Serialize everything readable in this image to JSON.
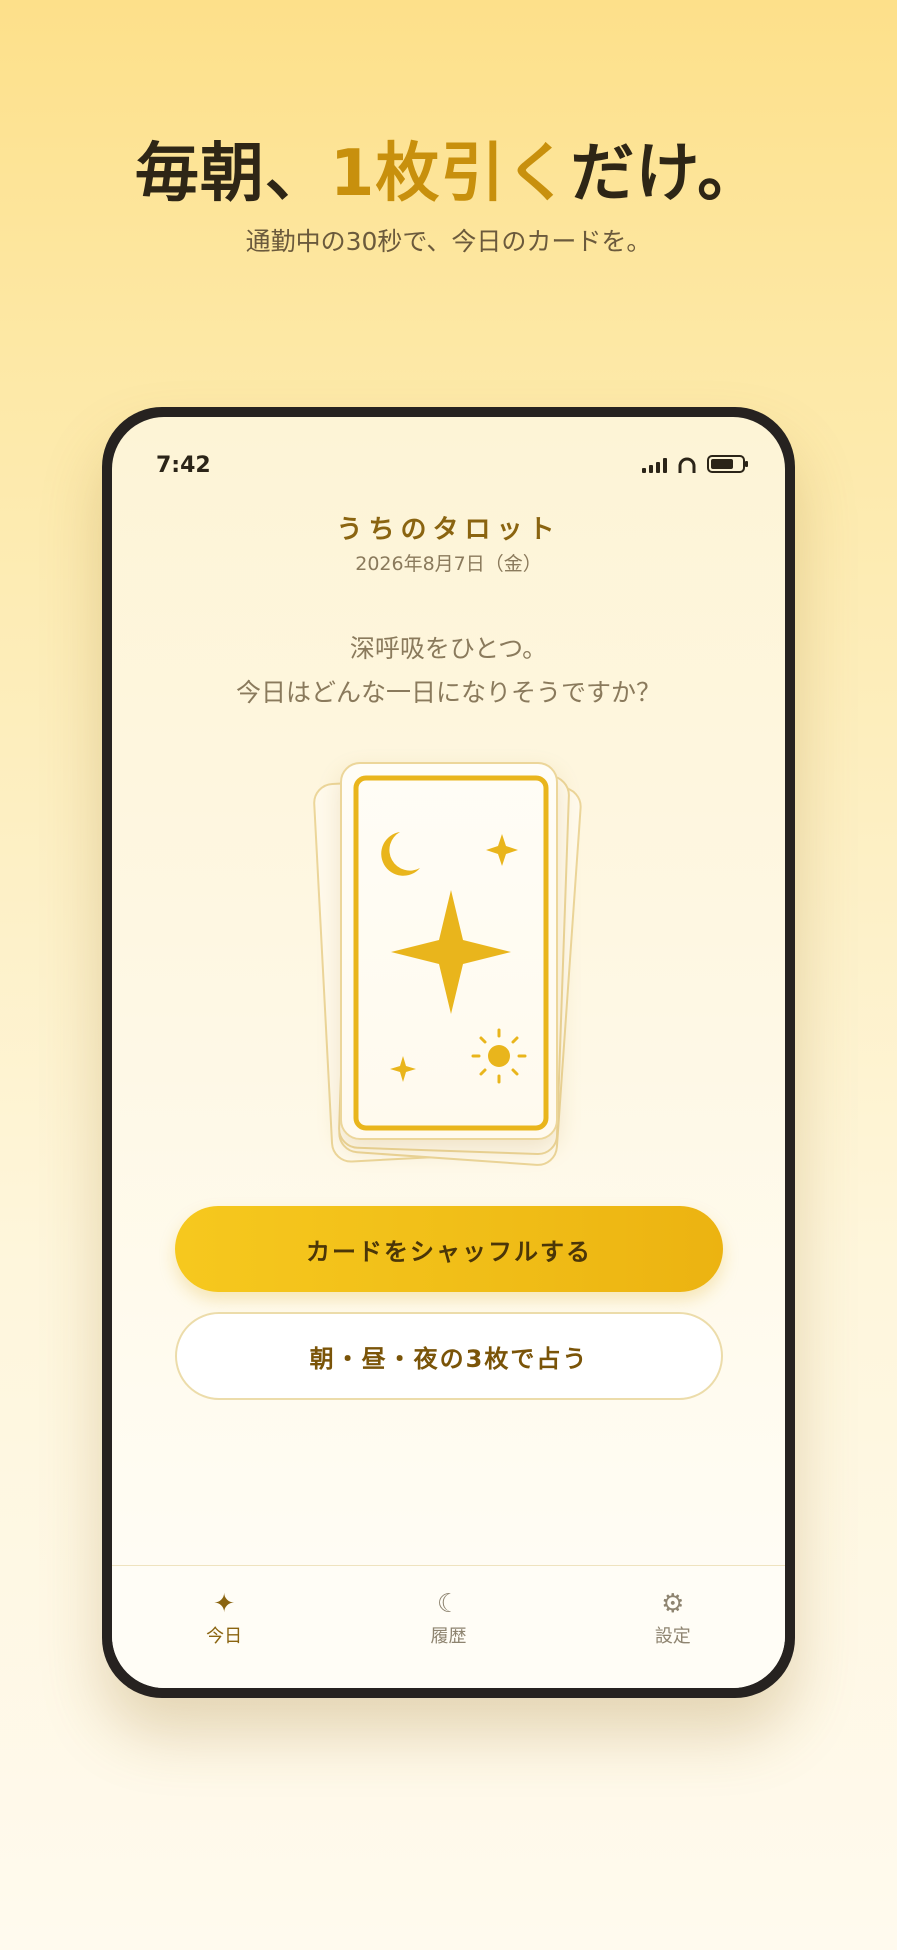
{
  "promo": {
    "headline_pre": "毎朝、",
    "headline_accent": "1枚引く",
    "headline_post": "だけ。",
    "subline": "通勤中の30秒で、今日のカードを。"
  },
  "status_bar": {
    "time": "7:42"
  },
  "app": {
    "title": "うちのタロット",
    "date": "2026年8月7日（金）",
    "prompt_line1": "深呼吸をひとつ。",
    "prompt_line2": "今日はどんな一日になりそうですか？"
  },
  "card": {
    "icons": [
      "crescent-moon-icon",
      "sparkle-icon",
      "four-point-star-icon",
      "sun-icon"
    ]
  },
  "buttons": {
    "shuffle_label": "カードをシャッフルする",
    "three_card_label": "朝・昼・夜の3枚で占う"
  },
  "tabbar": {
    "items": [
      {
        "label": "今日",
        "icon": "✦",
        "active": true
      },
      {
        "label": "履歴",
        "icon": "☾",
        "active": false
      },
      {
        "label": "設定",
        "icon": "⚙",
        "active": false
      }
    ]
  },
  "colors": {
    "accent": "#c8900d",
    "button_primary": "#f2c01a",
    "card_gold": "#e9b51c"
  }
}
